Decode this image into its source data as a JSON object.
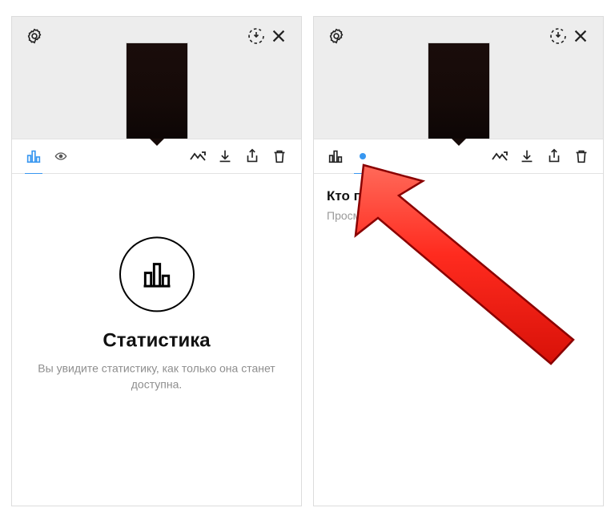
{
  "left": {
    "heading": "Статистика",
    "sub": "Вы увидите статистику, как только она станет доступна."
  },
  "right": {
    "heading": "Кто посмо",
    "sub": "Просмотров по"
  },
  "colors": {
    "accent": "#3897f0",
    "arrow_fill": "#ff2b1f",
    "arrow_stroke": "#a00000"
  }
}
